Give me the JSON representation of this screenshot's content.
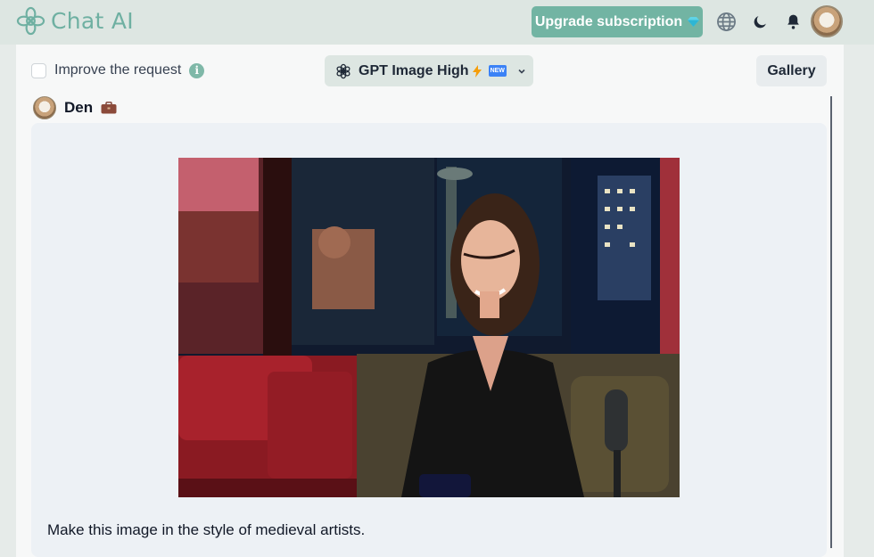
{
  "header": {
    "app_name": "Chat AI",
    "upgrade_label": "Upgrade subscription",
    "icons": [
      "globe-icon",
      "moon-icon",
      "bell-icon"
    ],
    "accent_color": "#72b4a3"
  },
  "toolbar": {
    "improve_label": "Improve the request",
    "improve_checked": false,
    "model_name": "GPT Image High",
    "model_badge": "NEW",
    "gallery_label": "Gallery"
  },
  "message": {
    "user_name": "Den",
    "text": "Make this image in the style of medieval artists."
  }
}
